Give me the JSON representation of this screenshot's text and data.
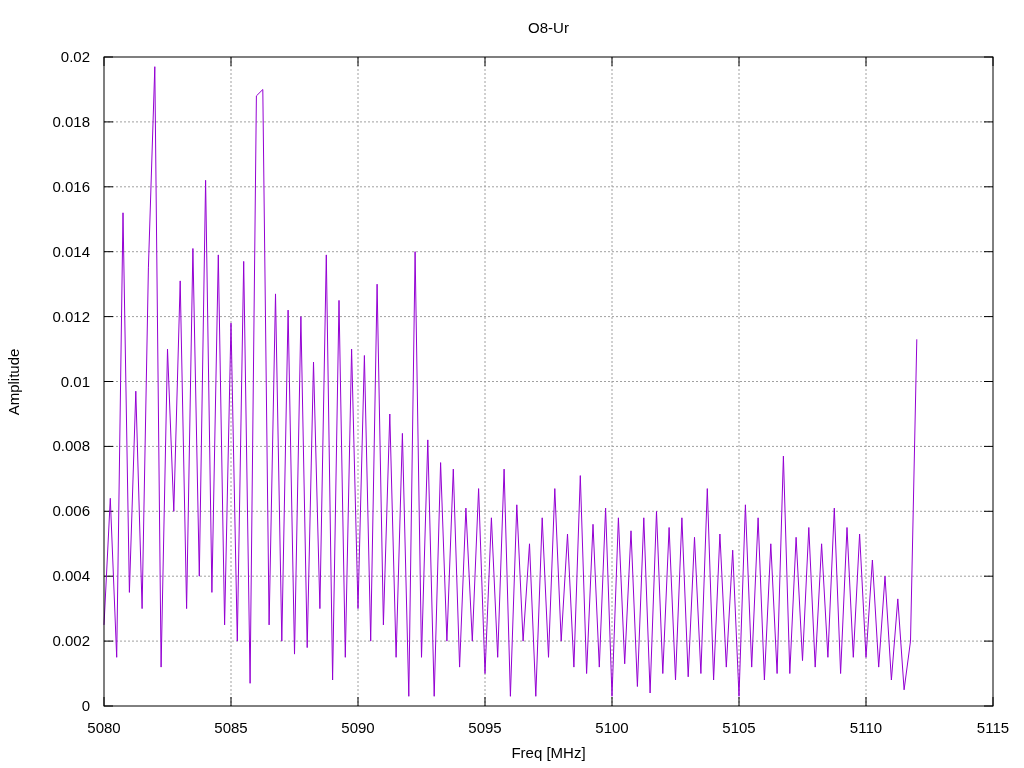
{
  "chart_data": {
    "type": "line",
    "grid": true,
    "title": "O8-Ur",
    "xlabel": "Freq [MHz]",
    "ylabel": "Amplitude",
    "xlim": [
      5080,
      5115
    ],
    "ylim": [
      0,
      0.02
    ],
    "xticks": [
      5080,
      5085,
      5090,
      5095,
      5100,
      5105,
      5110,
      5115
    ],
    "yticks": [
      {
        "value": 0,
        "label": "0"
      },
      {
        "value": 0.002,
        "label": "0.002"
      },
      {
        "value": 0.004,
        "label": "0.004"
      },
      {
        "value": 0.006,
        "label": "0.006"
      },
      {
        "value": 0.008,
        "label": "0.008"
      },
      {
        "value": 0.01,
        "label": "0.01"
      },
      {
        "value": 0.012,
        "label": "0.012"
      },
      {
        "value": 0.014,
        "label": "0.014"
      },
      {
        "value": 0.016,
        "label": "0.016"
      },
      {
        "value": 0.018,
        "label": "0.018"
      },
      {
        "value": 0.02,
        "label": "0.02"
      }
    ],
    "x": [
      5080,
      5080.25,
      5080.5,
      5080.75,
      5081,
      5081.25,
      5081.5,
      5081.75,
      5082,
      5082.25,
      5082.5,
      5082.75,
      5083,
      5083.25,
      5083.5,
      5083.75,
      5084,
      5084.25,
      5084.5,
      5084.75,
      5085,
      5085.25,
      5085.5,
      5085.75,
      5086,
      5086.25,
      5086.5,
      5086.75,
      5087,
      5087.25,
      5087.5,
      5087.75,
      5088,
      5088.25,
      5088.5,
      5088.75,
      5089,
      5089.25,
      5089.5,
      5089.75,
      5090,
      5090.25,
      5090.5,
      5090.75,
      5091,
      5091.25,
      5091.5,
      5091.75,
      5092,
      5092.25,
      5092.5,
      5092.75,
      5093,
      5093.25,
      5093.5,
      5093.75,
      5094,
      5094.25,
      5094.5,
      5094.75,
      5095,
      5095.25,
      5095.5,
      5095.75,
      5096,
      5096.25,
      5096.5,
      5096.75,
      5097,
      5097.25,
      5097.5,
      5097.75,
      5098,
      5098.25,
      5098.5,
      5098.75,
      5099,
      5099.25,
      5099.5,
      5099.75,
      5100,
      5100.25,
      5100.5,
      5100.75,
      5101,
      5101.25,
      5101.5,
      5101.75,
      5102,
      5102.25,
      5102.5,
      5102.75,
      5103,
      5103.25,
      5103.5,
      5103.75,
      5104,
      5104.25,
      5104.5,
      5104.75,
      5105,
      5105.25,
      5105.5,
      5105.75,
      5106,
      5106.25,
      5106.5,
      5106.75,
      5107,
      5107.25,
      5107.5,
      5107.75,
      5108,
      5108.25,
      5108.5,
      5108.75,
      5109,
      5109.25,
      5109.5,
      5109.75,
      5110,
      5110.25,
      5110.5,
      5110.75,
      5111,
      5111.25,
      5111.5,
      5111.75,
      5112
    ],
    "series": [
      {
        "color": "#9400d3",
        "values": [
          0.0025,
          0.0064,
          0.0015,
          0.0152,
          0.0035,
          0.0097,
          0.003,
          0.0135,
          0.0197,
          0.0012,
          0.011,
          0.006,
          0.0131,
          0.003,
          0.0141,
          0.004,
          0.0162,
          0.0035,
          0.0139,
          0.0025,
          0.0118,
          0.002,
          0.0137,
          0.0007,
          0.0188,
          0.019,
          0.0025,
          0.0127,
          0.002,
          0.0122,
          0.0016,
          0.012,
          0.0018,
          0.0106,
          0.003,
          0.0139,
          0.0008,
          0.0125,
          0.0015,
          0.011,
          0.003,
          0.0108,
          0.002,
          0.013,
          0.0025,
          0.009,
          0.0015,
          0.0084,
          0.0003,
          0.014,
          0.0015,
          0.0082,
          0.0003,
          0.0075,
          0.002,
          0.0073,
          0.0012,
          0.0061,
          0.002,
          0.0067,
          0.001,
          0.0058,
          0.0015,
          0.0073,
          0.0003,
          0.0062,
          0.002,
          0.005,
          0.0003,
          0.0058,
          0.0015,
          0.0067,
          0.002,
          0.0053,
          0.0012,
          0.0071,
          0.001,
          0.0056,
          0.0012,
          0.0061,
          0.0003,
          0.0058,
          0.0013,
          0.0054,
          0.0006,
          0.0058,
          0.0004,
          0.006,
          0.001,
          0.0055,
          0.0008,
          0.0058,
          0.0009,
          0.0052,
          0.001,
          0.0067,
          0.0008,
          0.0053,
          0.0012,
          0.0048,
          0.0003,
          0.0062,
          0.0012,
          0.0058,
          0.0008,
          0.005,
          0.001,
          0.0077,
          0.001,
          0.0052,
          0.0014,
          0.0055,
          0.0012,
          0.005,
          0.0015,
          0.0061,
          0.001,
          0.0055,
          0.0015,
          0.0053,
          0.0015,
          0.0045,
          0.0012,
          0.004,
          0.0008,
          0.0033,
          0.0005,
          0.002,
          0.0113
        ]
      }
    ]
  }
}
